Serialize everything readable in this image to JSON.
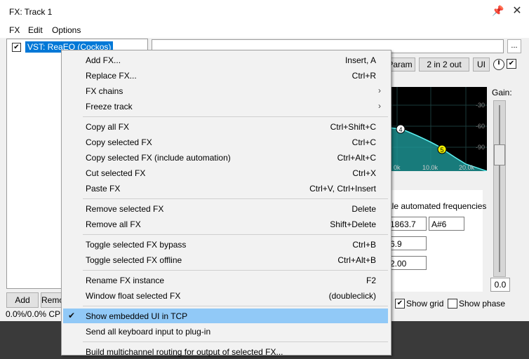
{
  "window": {
    "title": "FX: Track 1",
    "pin_icon": "pin-icon",
    "close_icon": "close-icon"
  },
  "menubar": {
    "items": [
      "FX",
      "Edit",
      "Options"
    ]
  },
  "fx_list": {
    "items": [
      {
        "label": "VST: ReaEQ (Cockos)",
        "enabled": true
      }
    ]
  },
  "toolbar": {
    "dots_label": "...",
    "param_label": "Param",
    "io_label": "2 in 2 out",
    "ui_label": "UI"
  },
  "graph": {
    "point_4": "4",
    "point_5": "5",
    "xticks": [
      "0k",
      "10.0k",
      "20.0k"
    ],
    "yticks": [
      "-30",
      "-60",
      "-90"
    ]
  },
  "gain": {
    "label": "Gain:",
    "value": "0.0",
    "level": 0.5
  },
  "eq_panel": {
    "scale_text": "ale automated frequencies",
    "freq_value": "1863.7",
    "note_value": "A#6",
    "gain_value": "6.9",
    "bw_value": "2.00"
  },
  "bottom": {
    "add_label": "Add",
    "remove_label": "Remo",
    "cpu_text": "0.0%/0.0% CPU",
    "show_grid_label": "Show grid",
    "show_grid_checked": true,
    "show_phase_label": "Show phase",
    "show_phase_checked": false
  },
  "context_menu": {
    "items": [
      {
        "label": "Add FX...",
        "shortcut": "Insert, A"
      },
      {
        "label": "Replace FX...",
        "shortcut": "Ctrl+R"
      },
      {
        "label": "FX chains",
        "shortcut": "",
        "submenu": true
      },
      {
        "label": "Freeze track",
        "shortcut": "",
        "submenu": true
      },
      {
        "label": "Copy all FX",
        "shortcut": "Ctrl+Shift+C"
      },
      {
        "label": "Copy selected FX",
        "shortcut": "Ctrl+C"
      },
      {
        "label": "Copy selected FX (include automation)",
        "shortcut": "Ctrl+Alt+C"
      },
      {
        "label": "Cut selected FX",
        "shortcut": "Ctrl+X"
      },
      {
        "label": "Paste FX",
        "shortcut": "Ctrl+V, Ctrl+Insert"
      },
      {
        "label": "Remove selected FX",
        "shortcut": "Delete"
      },
      {
        "label": "Remove all FX",
        "shortcut": "Shift+Delete"
      },
      {
        "label": "Toggle selected FX bypass",
        "shortcut": "Ctrl+B"
      },
      {
        "label": "Toggle selected FX offline",
        "shortcut": "Ctrl+Alt+B"
      },
      {
        "label": "Rename FX instance",
        "shortcut": "F2"
      },
      {
        "label": "Window float selected FX",
        "shortcut": "(doubleclick)"
      },
      {
        "label": "Show embedded UI in TCP",
        "shortcut": "",
        "checked": true,
        "highlighted": true
      },
      {
        "label": "Send all keyboard input to plug-in",
        "shortcut": ""
      },
      {
        "label": "Build multichannel routing for output of selected FX...",
        "shortcut": ""
      }
    ]
  }
}
